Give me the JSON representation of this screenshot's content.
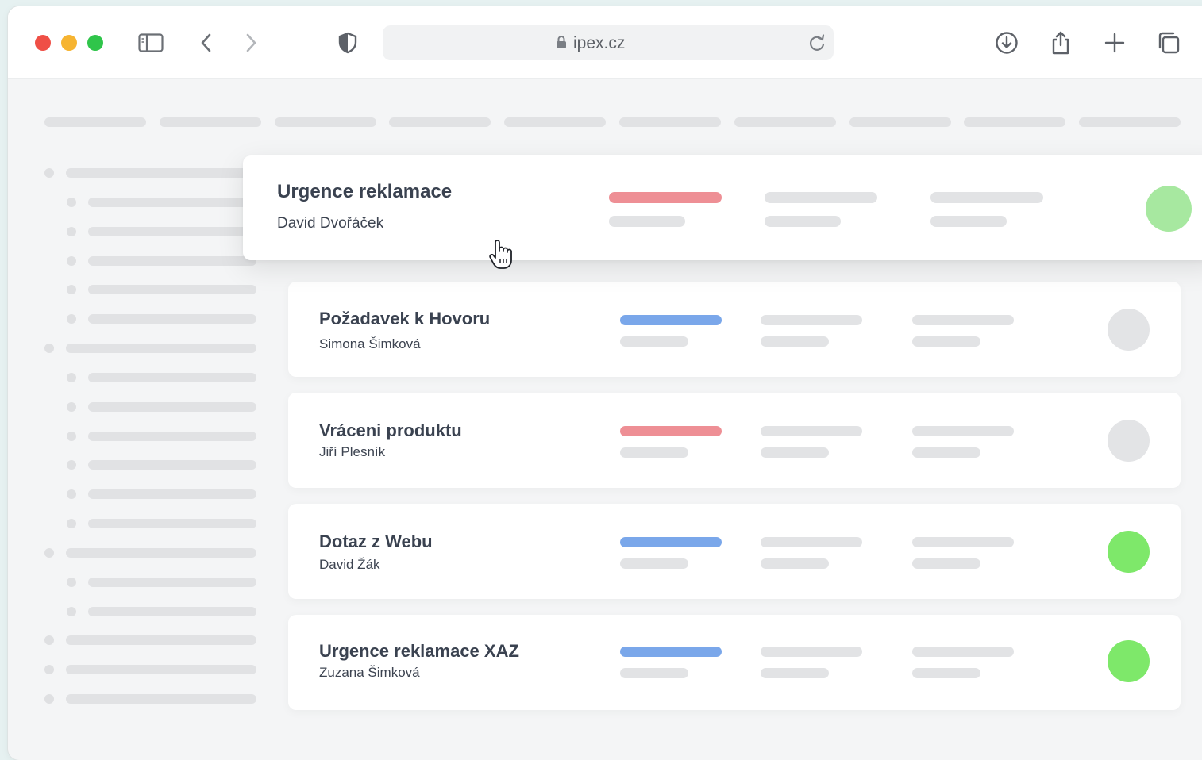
{
  "browser": {
    "url": "ipex.cz",
    "icons": [
      "sidebar-icon",
      "back-icon",
      "forward-icon",
      "shield-icon",
      "lock-icon",
      "reload-icon",
      "download-icon",
      "share-icon",
      "new-tab-icon",
      "tabs-overview-icon"
    ]
  },
  "colors": {
    "pill_red": "#ee8f95",
    "pill_blue": "#7aa7ea",
    "status_green": "#7ee86a",
    "status_light_green": "#a7e8a0",
    "status_gray": "#e3e4e6"
  },
  "requests": [
    {
      "title": "Urgence reklamace",
      "person": "David Dvořáček",
      "tag_color": "red",
      "status": "light-green",
      "hovered": true
    },
    {
      "title": "Požadavek k Hovoru",
      "person": "Simona Šimková",
      "tag_color": "blue",
      "status": "gray"
    },
    {
      "title": "Vráceni produktu",
      "person": "Jiří Plesník",
      "tag_color": "red",
      "status": "gray"
    },
    {
      "title": "Dotaz z Webu",
      "person": "David Žák",
      "tag_color": "blue",
      "status": "green"
    },
    {
      "title": "Urgence reklamace XAZ",
      "person": "Zuzana Šimková",
      "tag_color": "blue",
      "status": "green"
    }
  ]
}
